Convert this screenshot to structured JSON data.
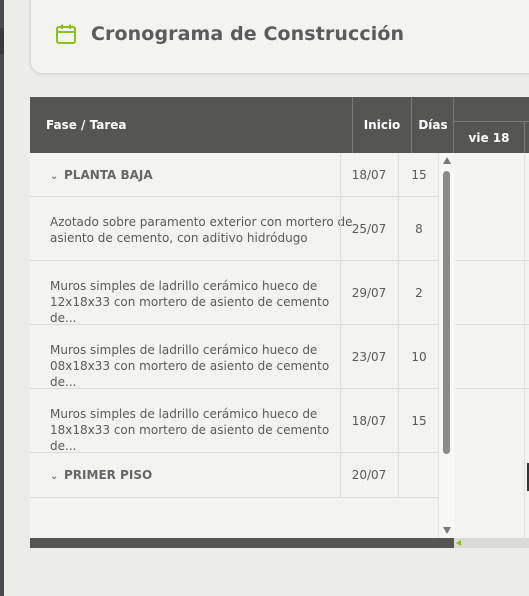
{
  "header": {
    "title": "Cronograma de Construcción",
    "icon": "calendar-icon",
    "accent": "#8dbf1f"
  },
  "grid": {
    "columns": {
      "task": "Fase / Tarea",
      "start": "Inicio",
      "days": "Días"
    },
    "dates": [
      "vie 18"
    ],
    "rows": [
      {
        "type": "group",
        "label": "PLANTA BAJA",
        "start": "18/07",
        "days": "15"
      },
      {
        "type": "task",
        "line1": "Azotado sobre paramento exterior con mortero de",
        "line2": "asiento de cemento, con aditivo hidródugo",
        "start": "25/07",
        "days": "8"
      },
      {
        "type": "task",
        "line1": "Muros simples de ladrillo cerámico hueco de",
        "line2": "12x18x33 con mortero de asiento de cemento de...",
        "start": "29/07",
        "days": "2"
      },
      {
        "type": "task",
        "line1": "Muros simples de ladrillo cerámico hueco de",
        "line2": "08x18x33 con mortero de asiento de cemento de...",
        "start": "23/07",
        "days": "10"
      },
      {
        "type": "task",
        "line1": "Muros simples de ladrillo cerámico hueco de",
        "line2": "18x18x33 con mortero de asiento de cemento de...",
        "start": "18/07",
        "days": "15"
      },
      {
        "type": "group",
        "label": "PRIMER PISO",
        "start": "20/07",
        "days": ""
      }
    ]
  }
}
